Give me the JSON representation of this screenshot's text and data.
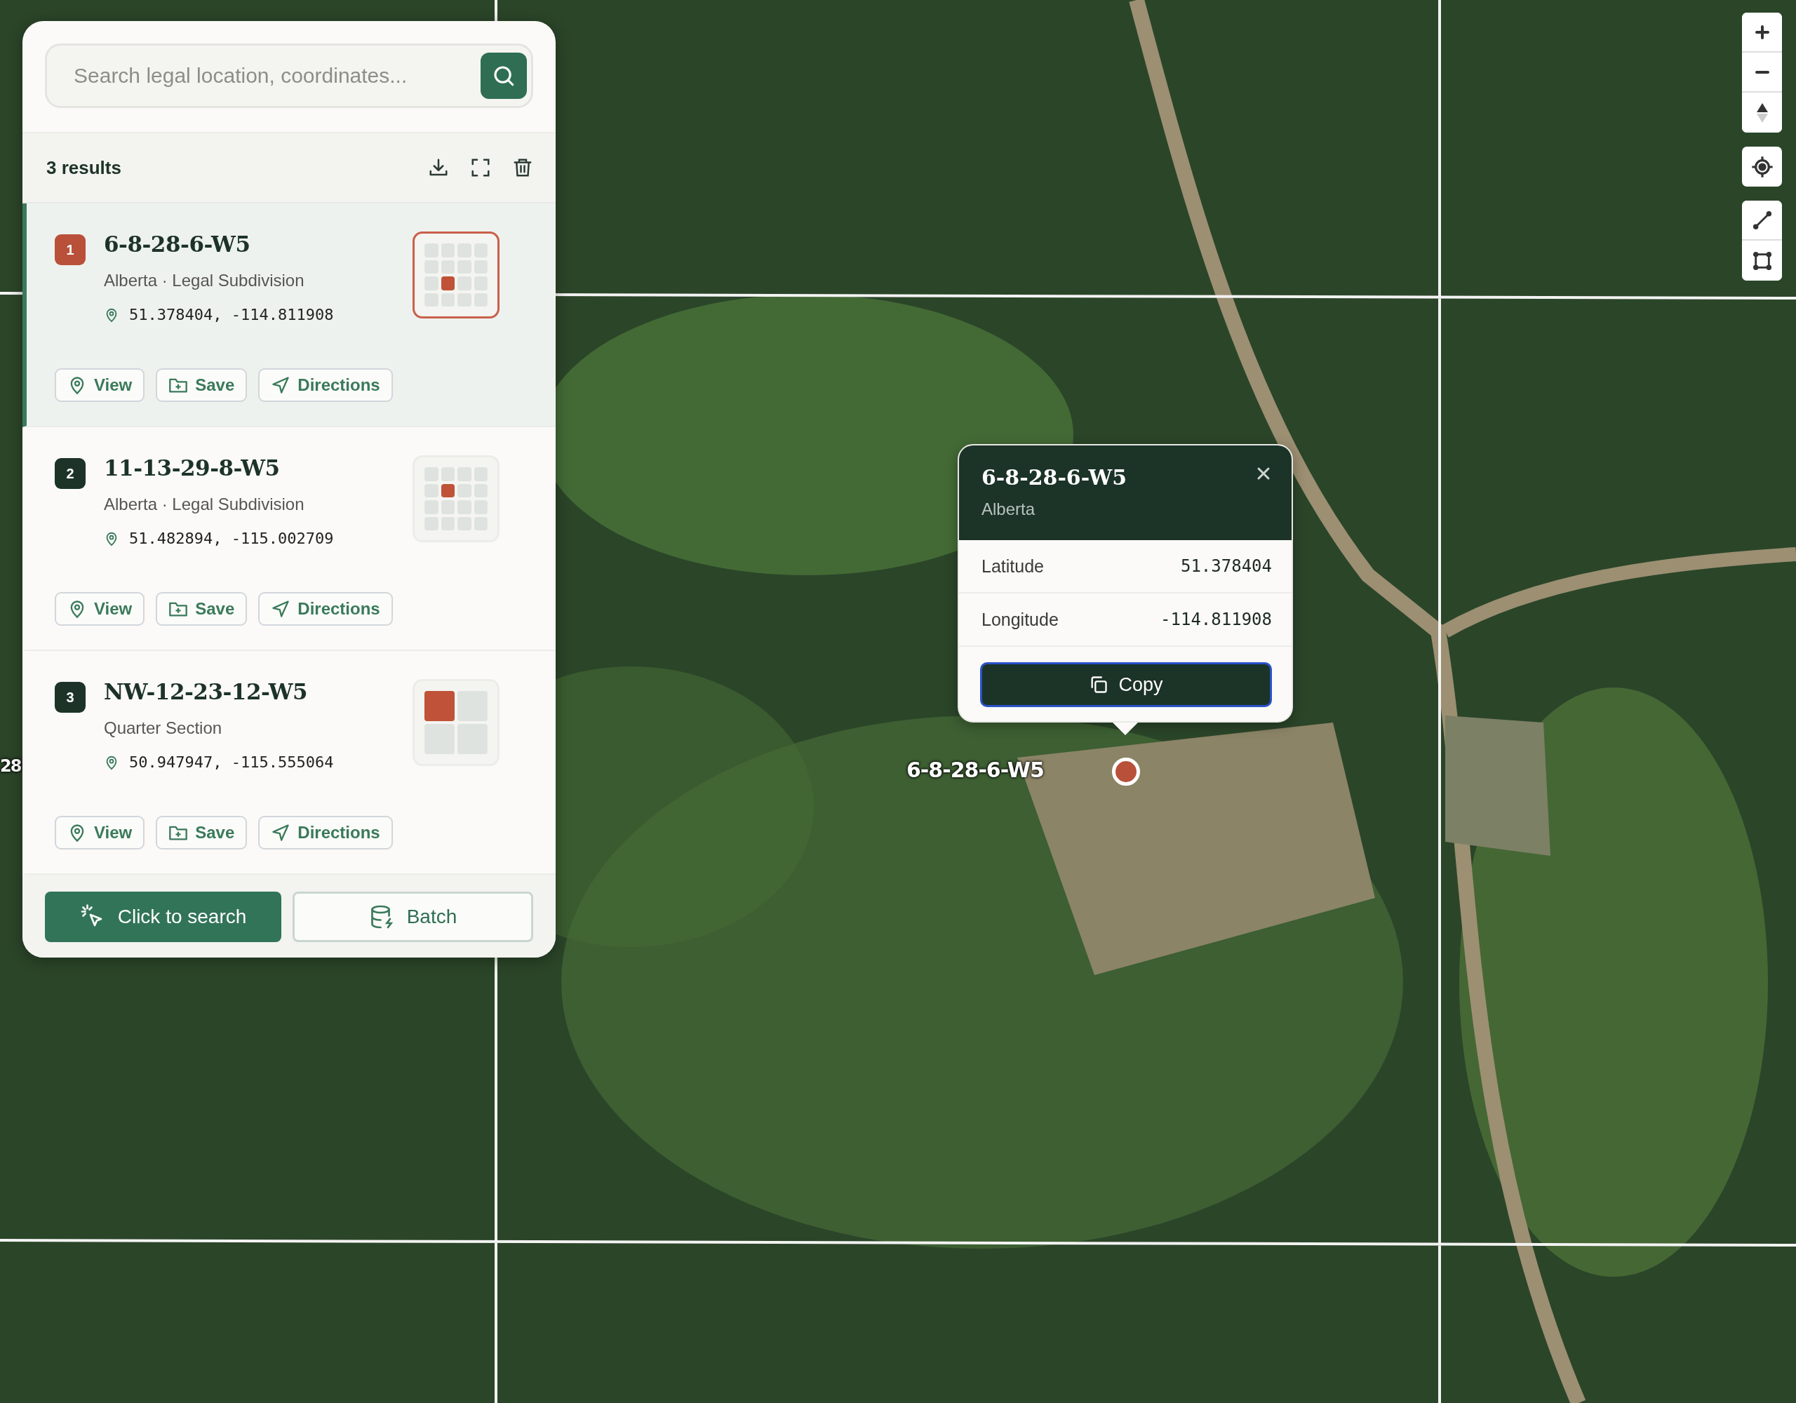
{
  "search": {
    "placeholder": "Search legal location, coordinates..."
  },
  "results_header": {
    "count": "3 results"
  },
  "results": [
    {
      "number": "1",
      "title": "6-8-28-6-W5",
      "subtitle": "Alberta · Legal Subdivision",
      "coordinates": "51.378404, -114.811908",
      "selected": true,
      "grid": [
        [
          false,
          false,
          false,
          false
        ],
        [
          false,
          false,
          false,
          false
        ],
        [
          false,
          true,
          false,
          false
        ],
        [
          false,
          false,
          false,
          false
        ]
      ],
      "actions": [
        {
          "kind": "view",
          "label": "View"
        },
        {
          "kind": "save",
          "label": "Save"
        },
        {
          "kind": "directions",
          "label": "Directions"
        }
      ]
    },
    {
      "number": "2",
      "title": "11-13-29-8-W5",
      "subtitle": "Alberta · Legal Subdivision",
      "coordinates": "51.482894, -115.002709",
      "selected": false,
      "grid": [
        [
          false,
          false,
          false,
          false
        ],
        [
          false,
          true,
          false,
          false
        ],
        [
          false,
          false,
          false,
          false
        ],
        [
          false,
          false,
          false,
          false
        ]
      ],
      "actions": [
        {
          "kind": "view",
          "label": "View"
        },
        {
          "kind": "save",
          "label": "Save"
        },
        {
          "kind": "directions",
          "label": "Directions"
        }
      ]
    },
    {
      "number": "3",
      "title": "NW-12-23-12-W5",
      "subtitle": "Quarter Section",
      "coordinates": "50.947947, -115.555064",
      "selected": false,
      "grid": [
        [
          true,
          false
        ],
        [
          false,
          false
        ]
      ],
      "actions": [
        {
          "kind": "view",
          "label": "View"
        },
        {
          "kind": "save",
          "label": "Save"
        },
        {
          "kind": "directions",
          "label": "Directions"
        }
      ]
    }
  ],
  "bottom_actions": [
    {
      "kind": "primary",
      "label": "Click to search"
    },
    {
      "kind": "secondary",
      "label": "Batch"
    }
  ],
  "popup": {
    "title": "6-8-28-6-W5",
    "subtitle": "Alberta",
    "rows": [
      {
        "label": "Latitude",
        "value": "51.378404"
      },
      {
        "label": "Longitude",
        "value": "-114.811908"
      }
    ],
    "copy": {
      "label": "Copy",
      "focused": true
    }
  },
  "map_labels": [
    {
      "kind": "edge",
      "text": "28"
    },
    {
      "kind": "marker",
      "text": "6-8-28-6-W5"
    }
  ]
}
